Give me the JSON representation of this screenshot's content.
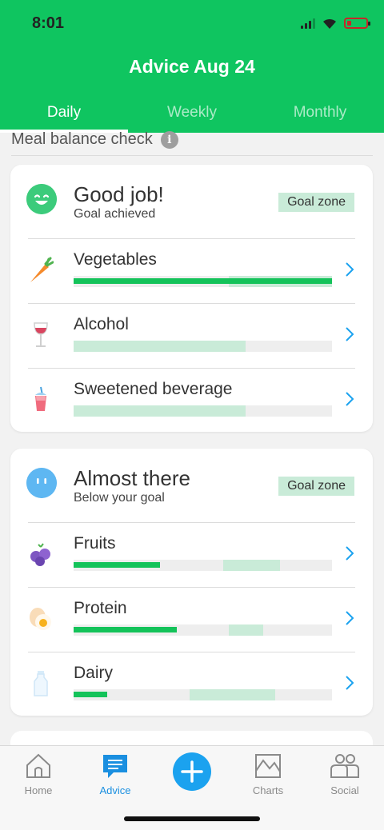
{
  "status": {
    "time": "8:01"
  },
  "header": {
    "title": "Advice Aug 24"
  },
  "tabs": [
    {
      "label": "Daily",
      "active": true
    },
    {
      "label": "Weekly",
      "active": false
    },
    {
      "label": "Monthly",
      "active": false
    }
  ],
  "section": {
    "label": "Meal balance check",
    "info_icon": "info-icon"
  },
  "cards": [
    {
      "face": "happy-face-icon",
      "title": "Good job!",
      "subtitle": "Goal achieved",
      "badge": "Goal zone",
      "rows": [
        {
          "label": "Vegetables",
          "icon": "carrot-icon",
          "fill": 1.0,
          "zone": [
            0.6,
            1.0
          ]
        },
        {
          "label": "Alcohol",
          "icon": "wine-glass-icon",
          "fill": 0.0,
          "zone": [
            0.0,
            0.665
          ]
        },
        {
          "label": "Sweetened beverage",
          "icon": "bubble-tea-icon",
          "fill": 0.0,
          "zone": [
            0.0,
            0.665
          ]
        }
      ]
    },
    {
      "face": "neutral-face-icon",
      "title": "Almost there",
      "subtitle": "Below your goal",
      "badge": "Goal zone",
      "rows": [
        {
          "label": "Fruits",
          "icon": "berries-icon",
          "fill": 0.335,
          "zone": [
            0.58,
            0.8
          ]
        },
        {
          "label": "Protein",
          "icon": "egg-icon",
          "fill": 0.4,
          "zone": [
            0.6,
            0.735
          ]
        },
        {
          "label": "Dairy",
          "icon": "milk-bottle-icon",
          "fill": 0.13,
          "zone": [
            0.45,
            0.78
          ]
        }
      ]
    }
  ],
  "nav": {
    "home": "Home",
    "advice": "Advice",
    "charts": "Charts",
    "social": "Social",
    "add": "add-icon"
  },
  "colors": {
    "brand": "#0fc560",
    "accent": "#1ba2ef",
    "fill": "#14c35a",
    "zone": "#c9ebd8"
  }
}
